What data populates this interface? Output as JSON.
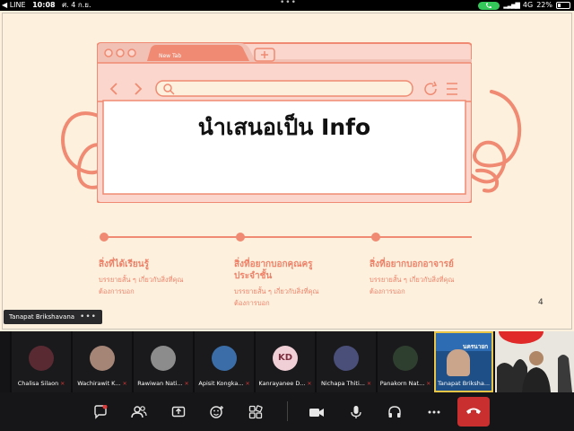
{
  "status_bar": {
    "back_app": "◀ LINE",
    "time": "10:08",
    "date": "ศ. 4 ก.ย.",
    "network": "4G",
    "battery_percent": "22%",
    "battery_level": 0.22,
    "call_color": "#34c759"
  },
  "slide": {
    "tab_title": "New Tab",
    "title": "นำเสนอเป็น Info",
    "slide_number": "4",
    "accent_color": "#f08a72",
    "columns": [
      {
        "heading": "สิ่งที่ได้เรียนรู้",
        "body": [
          "บรรยายสั้น ๆ เกี่ยวกับสิ่งที่คุณ",
          "ต้องการบอก"
        ]
      },
      {
        "heading": "สิ่งที่อยากบอกคุณครู",
        "heading2": "ประจำชั้น",
        "body": [
          "บรรยายสั้น ๆ เกี่ยวกับสิ่งที่คุณ",
          "ต้องการบอก"
        ]
      },
      {
        "heading": "สิ่งที่อยากบอกอาจารย์",
        "body": [
          "บรรยายสั้น ๆ เกี่ยวกับสิ่งที่คุณ",
          "ต้องการบอก"
        ]
      }
    ]
  },
  "presenter": {
    "name": "Tanapat Brikshavana",
    "more": "•••"
  },
  "participants": [
    {
      "name": "Chalisa Silaon",
      "avatar_color": "#5a2a33"
    },
    {
      "name": "Wachirawit K...",
      "avatar_color": "#a58576"
    },
    {
      "name": "Rawiwan Nati...",
      "avatar_color": "#8c8c8c"
    },
    {
      "name": "Apisit Kongka...",
      "avatar_color": "#3b6ea8"
    },
    {
      "name": "Kanrayanee D...",
      "initials": "KD"
    },
    {
      "name": "Nichapa Thiti...",
      "avatar_color": "#4a4f7a"
    },
    {
      "name": "Panakorn Nat...",
      "avatar_color": "#2f3f2f"
    },
    {
      "name": "Tanapat Briksha...",
      "avatar_color": "#6a8fb8",
      "video_caption": "นครนายก"
    }
  ],
  "toolbar": {
    "icons": [
      "chat-icon",
      "participants-icon",
      "share-screen-icon",
      "reactions-icon",
      "apps-icon",
      "camera-icon",
      "mic-icon",
      "audio-icon",
      "more-icon",
      "leave-icon"
    ]
  }
}
